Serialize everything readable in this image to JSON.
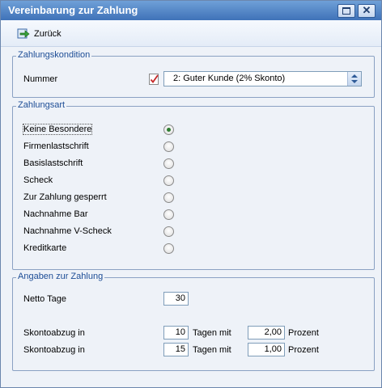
{
  "window": {
    "title": "Vereinbarung zur Zahlung"
  },
  "toolbar": {
    "back_label": "Zurück"
  },
  "zahlungskondition": {
    "legend": "Zahlungskondition",
    "label": "Nummer",
    "value": "2: Guter Kunde (2% Skonto)"
  },
  "zahlungsart": {
    "legend": "Zahlungsart",
    "options": [
      {
        "label": "Keine Besondere",
        "selected": true
      },
      {
        "label": "Firmenlastschrift",
        "selected": false
      },
      {
        "label": "Basislastschrift",
        "selected": false
      },
      {
        "label": "Scheck",
        "selected": false
      },
      {
        "label": "Zur Zahlung gesperrt",
        "selected": false
      },
      {
        "label": "Nachnahme Bar",
        "selected": false
      },
      {
        "label": "Nachnahme V-Scheck",
        "selected": false
      },
      {
        "label": "Kreditkarte",
        "selected": false
      }
    ]
  },
  "angaben": {
    "legend": "Angaben zur Zahlung",
    "netto_label": "Netto Tage",
    "netto_value": "30",
    "skonto_rows": [
      {
        "label": "Skontoabzug in",
        "days": "10",
        "days_suffix": "Tagen mit",
        "percent": "2,00",
        "percent_suffix": "Prozent"
      },
      {
        "label": "Skontoabzug in",
        "days": "15",
        "days_suffix": "Tagen mit",
        "percent": "1,00",
        "percent_suffix": "Prozent"
      }
    ]
  }
}
